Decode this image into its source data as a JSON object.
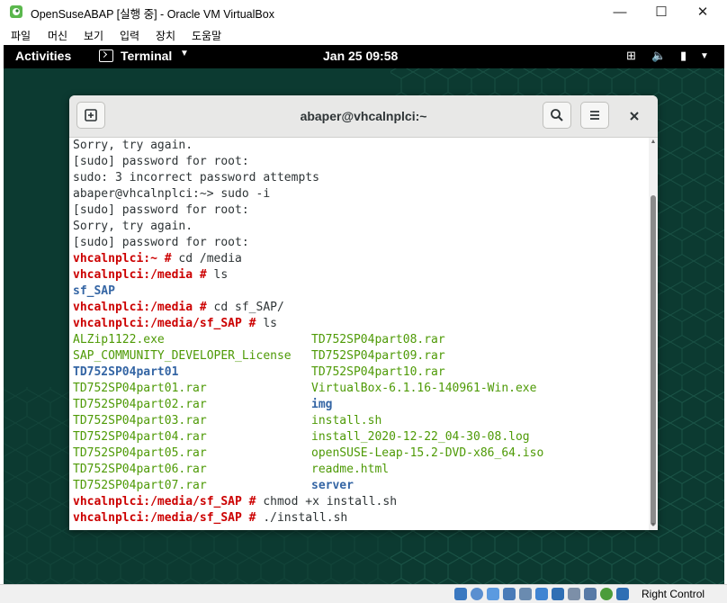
{
  "host": {
    "title": "OpenSuseABAP [실행 중] - Oracle VM VirtualBox",
    "controls": {
      "minimize": "—",
      "maximize": "☐",
      "close": "✕"
    },
    "menu": [
      "파일",
      "머신",
      "보기",
      "입력",
      "장치",
      "도움말"
    ],
    "status_host_key": "Right Control"
  },
  "gnome": {
    "activities": "Activities",
    "app": "Terminal",
    "caret": "▼",
    "clock": "Jan 25  09:58",
    "tray": {
      "network": "⊞",
      "volume": "🔈",
      "battery": "▮",
      "menu": "▼"
    }
  },
  "terminal": {
    "title": "abaper@vhcalnplci:~",
    "lines": [
      [
        {
          "t": "Sorry, try again.",
          "c": "file"
        }
      ],
      [
        {
          "t": "[sudo] password for root:",
          "c": "file"
        }
      ],
      [
        {
          "t": "sudo: 3 incorrect password attempts",
          "c": "file"
        }
      ],
      [
        {
          "t": "abaper@vhcalnplci:~> sudo -i",
          "c": "file"
        }
      ],
      [
        {
          "t": "[sudo] password for root:",
          "c": "file"
        }
      ],
      [
        {
          "t": "Sorry, try again.",
          "c": "file"
        }
      ],
      [
        {
          "t": "[sudo] password for root:",
          "c": "file"
        }
      ],
      [
        {
          "t": "vhcalnplci:~ # ",
          "c": "prompt"
        },
        {
          "t": "cd /media",
          "c": "file"
        }
      ],
      [
        {
          "t": "vhcalnplci:/media # ",
          "c": "prompt"
        },
        {
          "t": "ls",
          "c": "file"
        }
      ],
      [
        {
          "t": "sf_SAP",
          "c": "dir"
        }
      ],
      [
        {
          "t": "vhcalnplci:/media # ",
          "c": "prompt"
        },
        {
          "t": "cd sf_SAP/",
          "c": "file"
        }
      ],
      [
        {
          "t": "vhcalnplci:/media/sf_SAP # ",
          "c": "prompt"
        },
        {
          "t": "ls",
          "c": "file"
        }
      ],
      [
        {
          "t": "ALZip1122.exe",
          "c": "exe"
        },
        {
          "t": "TD752SP04part08.rar",
          "c": "exe",
          "col": 2
        }
      ],
      [
        {
          "t": "SAP_COMMUNITY_DEVELOPER_License",
          "c": "exe"
        },
        {
          "t": "TD752SP04part09.rar",
          "c": "exe",
          "col": 2
        }
      ],
      [
        {
          "t": "TD752SP04part01",
          "c": "dir"
        },
        {
          "t": "TD752SP04part10.rar",
          "c": "exe",
          "col": 2
        }
      ],
      [
        {
          "t": "TD752SP04part01.rar",
          "c": "exe"
        },
        {
          "t": "VirtualBox-6.1.16-140961-Win.exe",
          "c": "exe",
          "col": 2
        }
      ],
      [
        {
          "t": "TD752SP04part02.rar",
          "c": "exe"
        },
        {
          "t": "img",
          "c": "dir",
          "col": 2
        }
      ],
      [
        {
          "t": "TD752SP04part03.rar",
          "c": "exe"
        },
        {
          "t": "install.sh",
          "c": "exe",
          "col": 2
        }
      ],
      [
        {
          "t": "TD752SP04part04.rar",
          "c": "exe"
        },
        {
          "t": "install_2020-12-22_04-30-08.log",
          "c": "exe",
          "col": 2
        }
      ],
      [
        {
          "t": "TD752SP04part05.rar",
          "c": "exe"
        },
        {
          "t": "openSUSE-Leap-15.2-DVD-x86_64.iso",
          "c": "exe",
          "col": 2
        }
      ],
      [
        {
          "t": "TD752SP04part06.rar",
          "c": "exe"
        },
        {
          "t": "readme.html",
          "c": "exe",
          "col": 2
        }
      ],
      [
        {
          "t": "TD752SP04part07.rar",
          "c": "exe"
        },
        {
          "t": "server",
          "c": "dir",
          "col": 2
        }
      ],
      [
        {
          "t": "vhcalnplci:/media/sf_SAP # ",
          "c": "prompt"
        },
        {
          "t": "chmod +x install.sh",
          "c": "file"
        }
      ],
      [
        {
          "t": "vhcalnplci:/media/sf_SAP # ",
          "c": "prompt"
        },
        {
          "t": "./install.sh",
          "c": "file"
        }
      ]
    ]
  },
  "colors": {
    "prompt": "#cc0000",
    "executable": "#4e9a06",
    "directory": "#3465a4",
    "desktop": "#0f3d34",
    "topbar": "#000000"
  }
}
